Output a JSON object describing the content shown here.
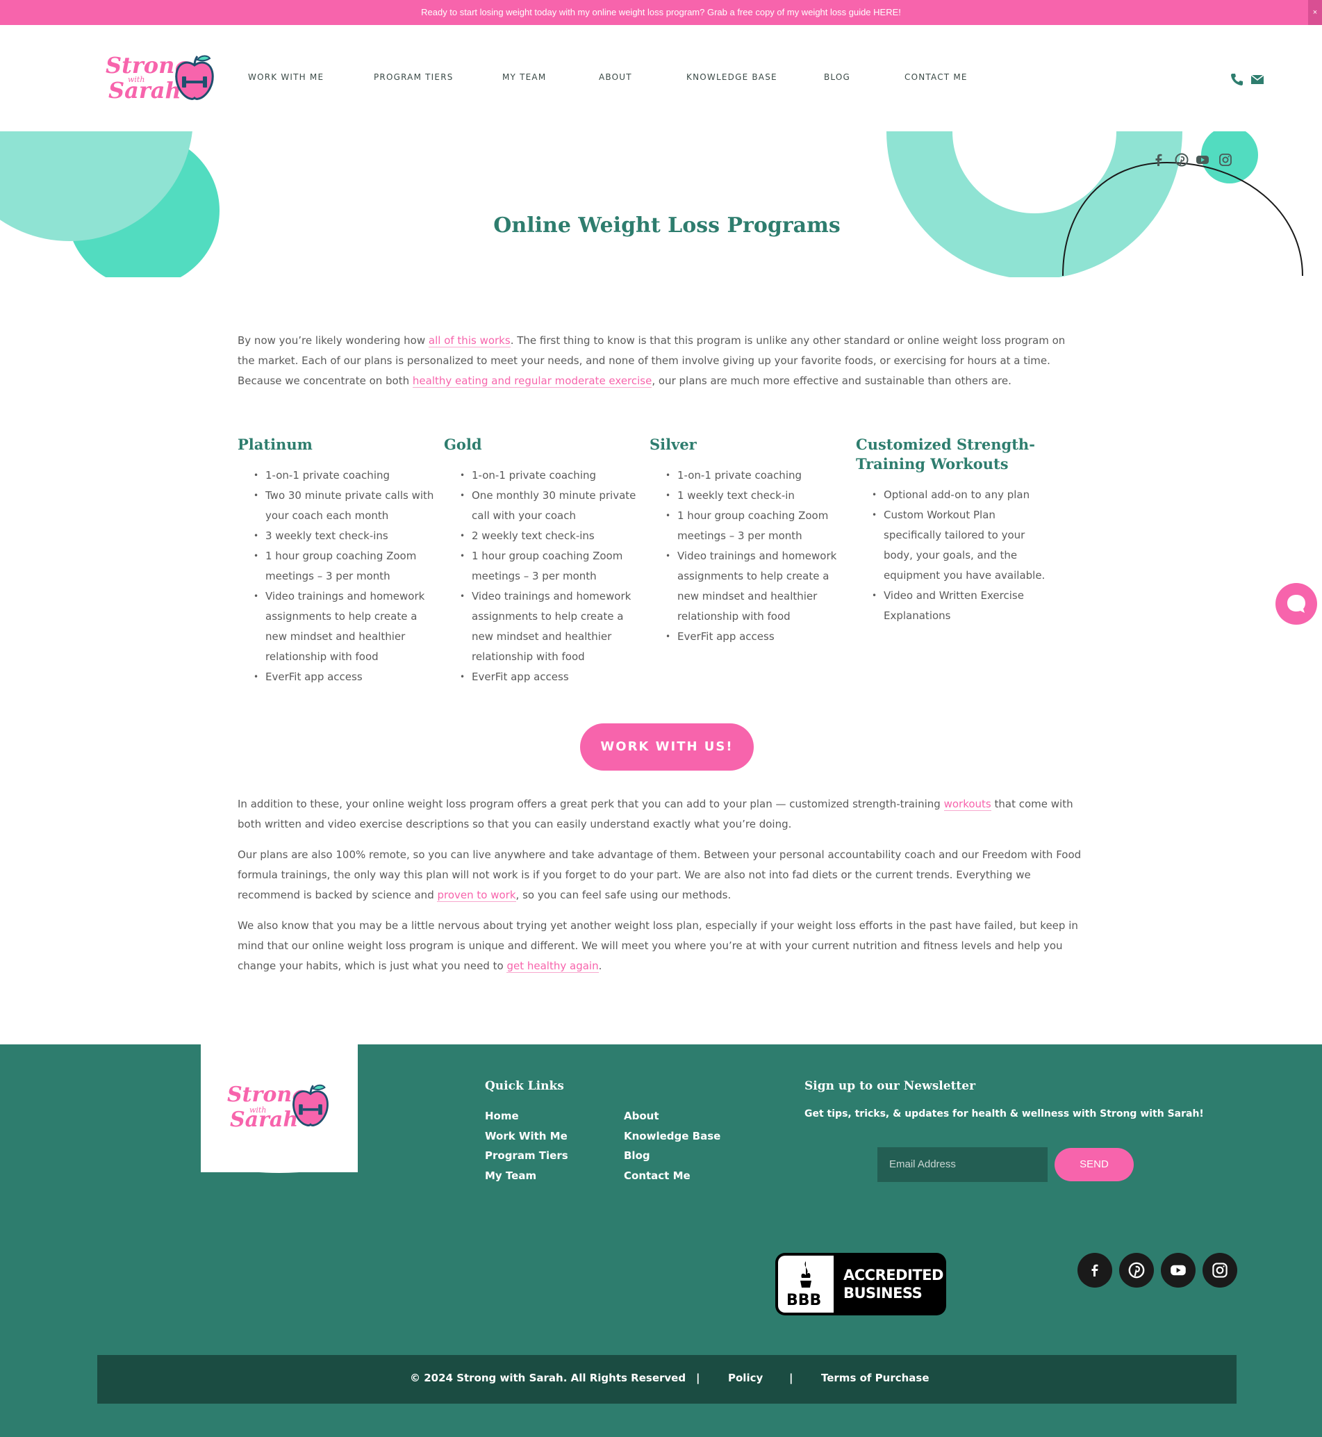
{
  "topbar": {
    "text": "Ready to start losing weight today with my online weight loss program? Grab a free copy of my weight loss guide HERE!",
    "close": "×"
  },
  "logo": {
    "line1": "Strong",
    "with": "with",
    "line2": "Sarah"
  },
  "nav": [
    "WORK WITH ME",
    "PROGRAM TIERS",
    "MY TEAM",
    "ABOUT",
    "KNOWLEDGE BASE",
    "BLOG",
    "CONTACT ME"
  ],
  "hero": {
    "title": "Online Weight Loss Programs"
  },
  "intro": {
    "t1": "By now you’re likely wondering how ",
    "link1": "all of this works",
    "t2": ". The first thing to know is that this program is unlike any other standard or online weight loss program on the market. Each of our plans is personalized to meet your needs, and none of them involve giving up your favorite foods, or exercising for hours at a time. Because we concentrate on both ",
    "link2": "healthy eating and regular moderate exercise",
    "t3": ", our plans are much more effective and sustainable than others are."
  },
  "plans": [
    {
      "title": "Platinum",
      "items": [
        "1-on-1 private coaching",
        "Two 30 minute private calls with your coach each month",
        "3 weekly text check-ins",
        "1 hour group coaching Zoom meetings – 3 per month",
        "Video trainings and homework assignments to help create a new mindset and healthier relationship with food",
        "EverFit app access"
      ]
    },
    {
      "title": "Gold",
      "items": [
        "1-on-1 private coaching",
        "One monthly 30 minute private call with your coach",
        "2 weekly text check-ins",
        "1 hour group coaching Zoom meetings – 3 per month",
        "Video trainings and homework assignments to help create a new mindset and healthier relationship with food",
        "EverFit app access"
      ]
    },
    {
      "title": "Silver",
      "items": [
        "1-on-1 private coaching",
        "1 weekly text check-in",
        "1 hour group coaching Zoom meetings – 3 per month",
        "Video trainings and homework assignments to help create a new mindset and healthier relationship with food",
        "EverFit app access"
      ]
    },
    {
      "title": "Customized Strength-Training Workouts",
      "items": [
        "Optional add-on to any plan",
        "Custom Workout Plan specifically tailored to your body, your goals, and the equipment you have available.",
        "Video and Written Exercise Explanations"
      ]
    }
  ],
  "cta": "WORK WITH US!",
  "para1": {
    "t1": "In addition to these, your online weight loss program offers a great perk that you can add to your plan — customized strength-training ",
    "link": "workouts",
    "t2": " that come with both written and video exercise descriptions so that you can easily understand exactly what you’re doing."
  },
  "para2": {
    "t1": "Our plans are also 100% remote, so you can live anywhere and take advantage of them. Between your personal accountability coach and our Freedom with Food formula trainings, the only way this plan will not work is if you forget to do your part. We are also not into fad diets or the current trends. Everything we recommend is backed by science and ",
    "link": "proven to work",
    "t2": ", so you can feel safe using our methods."
  },
  "para3": {
    "t1": "We also know that you may be a little nervous about trying yet another weight loss plan, especially if your weight loss efforts in the past have failed, but keep in mind that our online weight loss program is unique and different. We will meet you where you’re at with your current nutrition and fitness levels and help you change your habits, which is just what you need to ",
    "link": "get healthy again",
    "t2": "."
  },
  "footer": {
    "quick_links_title": "Quick Links",
    "links_col1": [
      "Home",
      "Work With Me",
      "Program Tiers",
      "My Team"
    ],
    "links_col2": [
      "About",
      "Knowledge Base",
      "Blog",
      "Contact Me"
    ],
    "newsletter_title": "Sign up to our Newsletter",
    "newsletter_text": "Get tips, tricks, & updates for health & wellness with Strong with Sarah!",
    "email_placeholder": "Email Address",
    "send": "SEND",
    "bbb_logo": "BBB",
    "bbb_line1": "ACCREDITED",
    "bbb_line2": "BUSINESS",
    "copyright": "© 2024 Strong with Sarah. All Rights Reserved",
    "sep": "|",
    "policy": "Policy",
    "terms": "Terms of Purchase"
  },
  "colors": {
    "pink": "#f764ac",
    "teal": "#2e7d6e",
    "mint": "#52dcc0",
    "mint_light": "#8fe3d3",
    "footer_dark": "#1b4c42"
  },
  "icons": {
    "phone": "phone-icon",
    "mail": "mail-icon",
    "facebook": "facebook-icon",
    "pinterest": "pinterest-icon",
    "youtube": "youtube-icon",
    "instagram": "instagram-icon",
    "chat": "chat-icon"
  }
}
